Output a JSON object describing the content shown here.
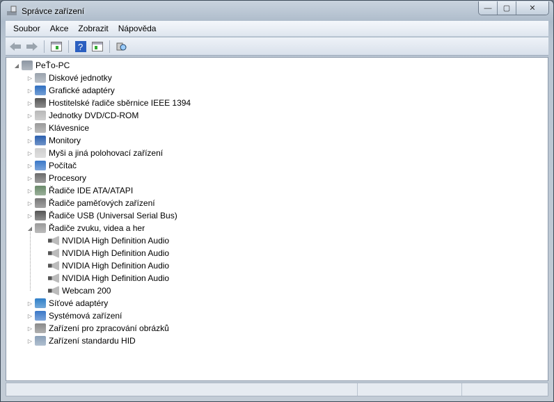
{
  "window": {
    "title": "Správce zařízení",
    "minimize": "—",
    "maximize": "▢",
    "close": "✕"
  },
  "menu": [
    "Soubor",
    "Akce",
    "Zobrazit",
    "Nápověda"
  ],
  "toolbar": [
    "back-icon",
    "forward-icon",
    "console-tree-icon",
    "help-icon",
    "properties-icon",
    "scan-hardware-icon"
  ],
  "tree": {
    "root": "PeŤo-PC",
    "categories": [
      {
        "label": "Diskové jednotky",
        "color": "#9aa3ad"
      },
      {
        "label": "Grafické adaptéry",
        "color": "#2f6fc0"
      },
      {
        "label": "Hostitelské řadiče sběrnice IEEE 1394",
        "color": "#555555"
      },
      {
        "label": "Jednotky DVD/CD-ROM",
        "color": "#b8b8b8"
      },
      {
        "label": "Klávesnice",
        "color": "#9a9a9a"
      },
      {
        "label": "Monitory",
        "color": "#2a5fae"
      },
      {
        "label": "Myši a jiná polohovací zařízení",
        "color": "#cfcfcf"
      },
      {
        "label": "Počítač",
        "color": "#3a78c8"
      },
      {
        "label": "Procesory",
        "color": "#6b6b6b"
      },
      {
        "label": "Řadiče IDE ATA/ATAPI",
        "color": "#6a8a6a"
      },
      {
        "label": "Řadiče paměťových zařízení",
        "color": "#777777"
      },
      {
        "label": "Řadiče USB (Universal Serial Bus)",
        "color": "#555555"
      },
      {
        "label": "Řadiče zvuku, videa a her",
        "color": "#9a9a9a",
        "expanded": true,
        "children": [
          "NVIDIA High Definition Audio",
          "NVIDIA High Definition Audio",
          "NVIDIA High Definition Audio",
          "NVIDIA High Definition Audio",
          "Webcam 200"
        ]
      },
      {
        "label": "Síťové adaptéry",
        "color": "#2f7fc8"
      },
      {
        "label": "Systémová zařízení",
        "color": "#3a78c8"
      },
      {
        "label": "Zařízení pro zpracování obrázků",
        "color": "#8a8a8a"
      },
      {
        "label": "Zařízení standardu HID",
        "color": "#8aa0b8"
      }
    ]
  }
}
